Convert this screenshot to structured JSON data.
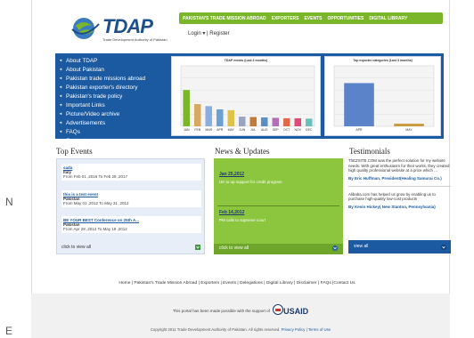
{
  "header": {
    "logo_text": "TDAP",
    "logo_sub": "Trade Development Authority of Pakistan",
    "nav": [
      "PAKISTAN'S TRADE MISSION ABROAD",
      "EXPORTERS",
      "EVENTS",
      "OPPORTUNITIES",
      "DIGITAL LIBRARY"
    ],
    "login": "Login ▾ | Register"
  },
  "menu": [
    "About TDAP",
    "About Pakistan",
    "Pakistan trade missions abroad",
    "Pakistan exporter's directory",
    "Pakistan's trade policy",
    "Important Links",
    "Picture/Video archive",
    "Advertisements",
    "FAQs",
    "Contact us"
  ],
  "charts": {
    "left_title": "TDAP events (Last 3 months)",
    "right_title": "Top exporter categories (Last 3 months)",
    "left_data": {
      "type": "bar",
      "categories": [
        "JAN",
        "FEB",
        "MAR",
        "APR",
        "MAY",
        "JUN",
        "JUL",
        "AUG",
        "SEP",
        "OCT",
        "NOV",
        "DEC"
      ],
      "values": [
        9,
        5.5,
        5,
        4.2,
        4,
        2.4,
        2.3,
        2.2,
        2.1,
        2,
        2,
        1.9
      ],
      "colors": [
        "#7ab52a",
        "#d7a85f",
        "#8aaee0",
        "#6aa0d6",
        "#e0c24a",
        "#9aa4c2",
        "#c07a3a",
        "#5b8fc4",
        "#b070b8",
        "#dd6a4a",
        "#e04a7a",
        "#6ac0c0"
      ],
      "ylim": [
        0,
        15
      ]
    },
    "right_data": {
      "type": "bar",
      "categories": [
        "APR",
        "MAY"
      ],
      "values": [
        500,
        30
      ],
      "colors": [
        "#5b83c9",
        "#c89a3c"
      ],
      "ylim": [
        0,
        700
      ]
    }
  },
  "events": {
    "title": "Top Events",
    "items": [
      {
        "title": "sada",
        "location": "Italy",
        "dates": "From Feb 01 ,2016 To Feb 28 ,2017"
      },
      {
        "title": "this is a test event",
        "location": "Pakistan",
        "dates": "From May 01 ,2012 To May 31 ,2012"
      },
      {
        "title": "BE YOUR BEST Conference on 25th A...",
        "location": "Pakistan",
        "dates": "From Apr 28 ,2012 To May 19 ,2012"
      }
    ],
    "view_all": "click to view all"
  },
  "news": {
    "title": "News & Updates",
    "items": [
      {
        "date": "Jan 25,2012",
        "text": "UK to up support for credit program"
      },
      {
        "date": "Feb 14,2012",
        "text": "PM calls to supreme court"
      }
    ],
    "view_all": "click to view all"
  },
  "testimonials": {
    "title": "Testimonials",
    "items": [
      {
        "text": "ThEZSITE.COM was the perfect solution for my website needs. With great enthusiasm for their works, they created high quality professional website at a price which ...",
        "by": "By Eric Huffman, President(Healing Samurai Co.)"
      },
      {
        "text": "Alibaba.com has helped us grow by enabling us to purchase high-quality low-cost products",
        "by": "By Kevin Hickey( New Stanton, Pennsylvania)"
      }
    ],
    "view_all": "view all"
  },
  "footer": {
    "links": "Home | Pakistan's Trade Mission Abroad | Exporters | Events | Delegations | Digital Library | Disclaimer | FAQs |Contact Us",
    "support": "This portal has been made possible with the support of",
    "usaid": "USAID",
    "copyright": "Copyright 2011 Trade Development Authority of Pakistan. All rights reserved.",
    "privacy": "Privacy Policy",
    "terms": "Terms of Use"
  },
  "side_glyphs": [
    "N",
    "E"
  ]
}
